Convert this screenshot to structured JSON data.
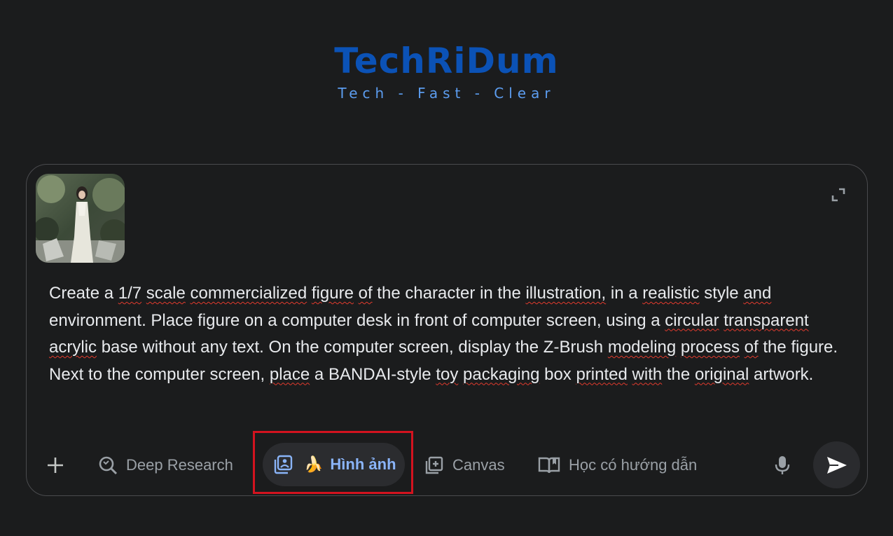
{
  "brand": {
    "title": "TechRiDum",
    "tagline": "Tech - Fast - Clear"
  },
  "composer": {
    "attachment_icon": "image-thumbnail",
    "expand_icon": "expand-icon",
    "prompt_words": [
      "Create",
      "a",
      "1/7",
      "scale",
      "commercialized",
      "figure",
      "of",
      "the",
      "character",
      "in",
      "the",
      "illustration,",
      "in",
      "a",
      "realistic",
      "style",
      "and",
      "environment.",
      "Place",
      "figure",
      "on",
      "a",
      "computer",
      "desk",
      "in",
      "front",
      "of",
      "computer",
      "screen,",
      "using",
      "a",
      "circular",
      "transparent",
      "acrylic",
      "base",
      "without",
      "any",
      "text.",
      "On",
      "the",
      "computer",
      "screen,",
      "display",
      "the",
      "Z-Brush",
      "modeling",
      "process",
      "of",
      "the",
      "figure.",
      "Next",
      "to",
      "the",
      "computer",
      "screen,",
      "place",
      "a",
      "BANDAI-style",
      "toy",
      "packaging",
      "box",
      "printed",
      "with",
      "the",
      "original",
      "artwork."
    ],
    "underlined_words": [
      2,
      3,
      4,
      5,
      6,
      11,
      14,
      16,
      31,
      32,
      33,
      45,
      46,
      47,
      55,
      58,
      59,
      61,
      62,
      64
    ]
  },
  "toolbar": {
    "add_icon": "plus-icon",
    "deep_research": {
      "label": "Deep Research",
      "icon": "deep-research-icon"
    },
    "images": {
      "label": "Hình ảnh",
      "icon": "image-gallery-icon",
      "emoji": "🍌",
      "accent": "#8ab4f8"
    },
    "canvas": {
      "label": "Canvas",
      "icon": "canvas-plus-icon"
    },
    "guided_learning": {
      "label": "Học có hướng dẫn",
      "icon": "open-book-icon"
    },
    "mic_icon": "microphone-icon",
    "send_icon": "send-arrow-icon"
  },
  "colors": {
    "background": "#1b1c1d",
    "brand_blue": "#0b52b6",
    "highlight_red": "#d3131f",
    "spell_underline": "#e33b2e"
  }
}
